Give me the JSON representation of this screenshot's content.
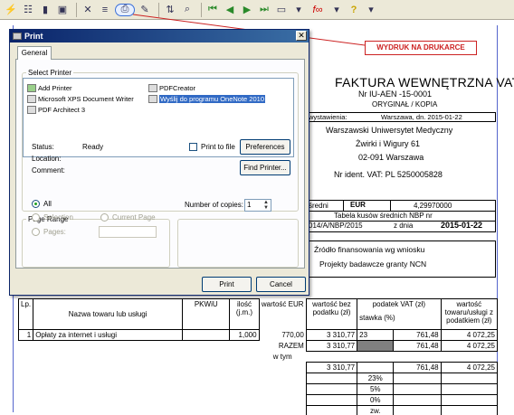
{
  "callout": {
    "text": "WYDRUK NA DRUKARCE"
  },
  "invoice": {
    "title": "FAKTURA WEWNĘTRZNA VAT",
    "number": "Nr  IU-AEN  -15-0001",
    "copy": "ORYGINAŁ / KOPIA",
    "issued_label": "wystawienia:",
    "issued_value": "Warszawa, dn. 2015-01-22",
    "seller": [
      "Warszawski Uniwersytet Medyczny",
      "Żwirki i Wigury 61",
      "02-091 Warszawa"
    ],
    "vat_id": "Nr ident. VAT: PL 5250005828",
    "rate_label": "średni",
    "currency": "EUR",
    "rate_value": "4,29970000",
    "table_label": "Tabela kusów średnich NBP nr",
    "table_nr": "014/A/NBP/2015",
    "date_label": "z dnia",
    "table_date": "2015-01-22",
    "financing": [
      "Źródło finansowania wg wniosku",
      "Projekty badawcze granty NCN"
    ],
    "headers": {
      "lp": "Lp.",
      "name": "Nazwa towaru lub usługi",
      "pkwiu": "PKWiU",
      "qty": "ilość (j.m.)",
      "value": "wartość EUR",
      "net": "wartość bez podatku (zł)",
      "vat": "podatek VAT (zł)",
      "vat_rate": "stawka (%)",
      "gross": "wartość towaru/usługi z podatkiem (zł)"
    },
    "row": {
      "lp": "1",
      "name": "Opłaty za internet i usługi",
      "qty": "1,000",
      "value": "770,00",
      "net": "3 310,77",
      "rate": "23",
      "vat": "761,48",
      "gross": "4 072,25"
    },
    "razem_label": "RAZEM",
    "razem_net": "3 310,77",
    "razem_vat": "761,48",
    "razem_gross": "4 072,25",
    "wtym_label": "w tym",
    "breakdown": [
      {
        "net": "3 310,77",
        "rate": "",
        "vat": "761,48",
        "gross": "4 072,25"
      },
      {
        "net": "",
        "rate": "23%",
        "vat": "",
        "gross": ""
      },
      {
        "net": "",
        "rate": "5%",
        "vat": "",
        "gross": ""
      },
      {
        "net": "",
        "rate": "0%",
        "vat": "",
        "gross": ""
      },
      {
        "net": "",
        "rate": "zw.",
        "vat": "",
        "gross": ""
      }
    ]
  },
  "dialog": {
    "title": "Print",
    "close": "✕",
    "tab_general": "General",
    "select_printer": "Select Printer",
    "printers": [
      {
        "name": "Add Printer"
      },
      {
        "name": "Microsoft XPS Document Writer"
      },
      {
        "name": "PDF Architect 3"
      },
      {
        "name": "PDFCreator"
      },
      {
        "name": "Wyślij do programu OneNote 2010"
      }
    ],
    "status_label": "Status:",
    "status_value": "Ready",
    "location_label": "Location:",
    "comment_label": "Comment:",
    "print_to_file": "Print to file",
    "preferences": "Preferences",
    "find_printer": "Find Printer...",
    "page_range": "Page Range",
    "all": "All",
    "selection": "Selection",
    "current_page": "Current Page",
    "pages": "Pages:",
    "copies_label": "Number of copies:",
    "copies_value": "1",
    "print_btn": "Print",
    "cancel_btn": "Cancel"
  }
}
